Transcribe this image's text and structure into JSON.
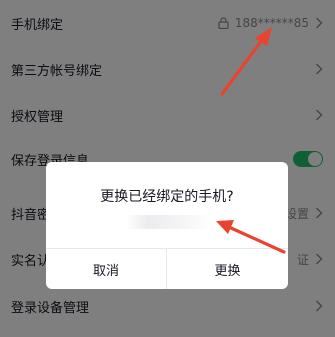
{
  "settings": {
    "rows": [
      {
        "label": "手机绑定",
        "value": "188******85",
        "has_lock": true,
        "has_chevron": true
      },
      {
        "label": "第三方帐号绑定",
        "value": "",
        "has_chevron": true
      },
      {
        "label": "授权管理",
        "value": "",
        "has_chevron": true
      },
      {
        "label": "保存登录信息",
        "value": "",
        "toggle_on": true
      },
      {
        "label": "抖音密",
        "value": "设置",
        "has_chevron": true
      },
      {
        "label": "实名认",
        "value": "证",
        "has_chevron": true
      },
      {
        "label": "登录设备管理",
        "value": "",
        "has_chevron": true
      }
    ]
  },
  "dialog": {
    "title": "更换已经绑定的手机?",
    "cancel_label": "取消",
    "confirm_label": "更换"
  },
  "colors": {
    "annotation_arrow": "#e8442f",
    "toggle_on": "#20c06c",
    "overlay": "rgba(0,0,0,0.5)"
  }
}
